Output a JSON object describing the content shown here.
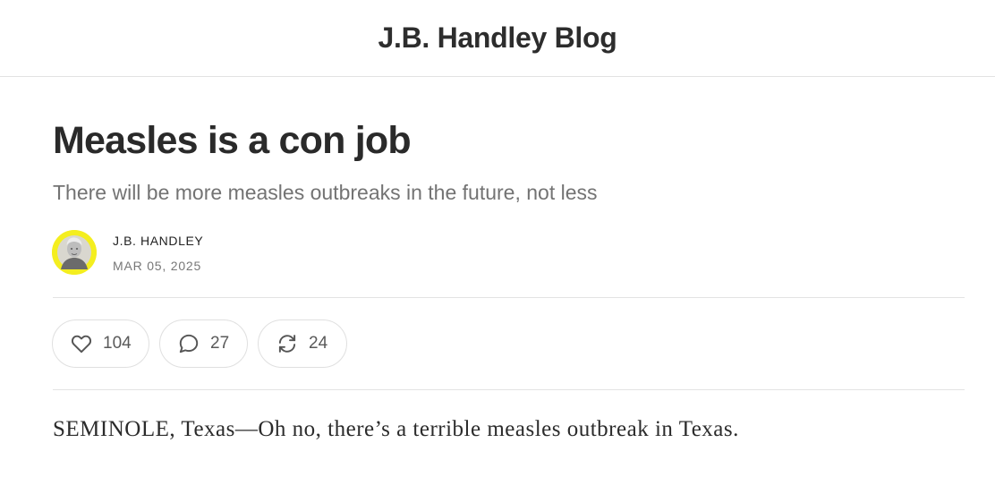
{
  "header": {
    "blog_title": "J.B. Handley Blog"
  },
  "post": {
    "title": "Measles is a con job",
    "subtitle": "There will be more measles outbreaks in the future, not less",
    "author": "J.B. HANDLEY",
    "date": "MAR 05, 2025",
    "avatar_color": "#f4ee1f"
  },
  "actions": {
    "likes": {
      "icon": "heart-icon",
      "count": "104"
    },
    "comments": {
      "icon": "comment-icon",
      "count": "27"
    },
    "restacks": {
      "icon": "restack-icon",
      "count": "24"
    }
  },
  "body": {
    "first_paragraph": "SEMINOLE, Texas—Oh no, there’s a terrible measles outbreak in Texas."
  }
}
